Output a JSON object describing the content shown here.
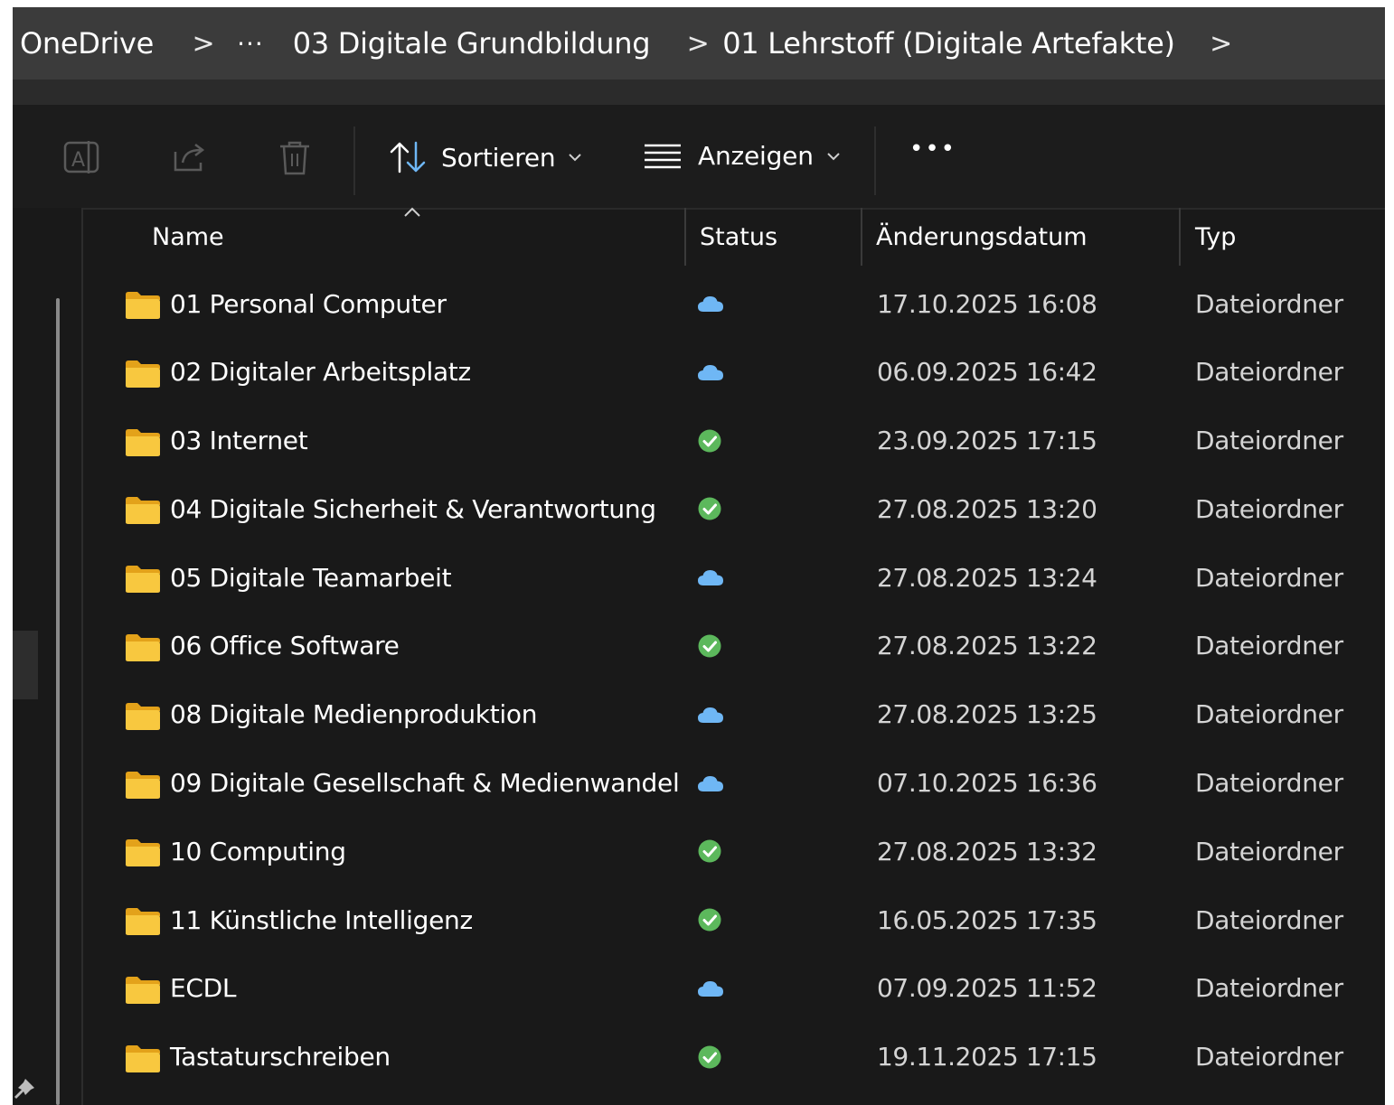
{
  "breadcrumb": {
    "items": [
      "OneDrive",
      "···",
      "03 Digitale Grundbildung",
      "01 Lehrstoff (Digitale Artefakte)"
    ],
    "separator": ">"
  },
  "toolbar": {
    "sort_label": "Sortieren",
    "view_label": "Anzeigen",
    "more_label": "•••"
  },
  "columns": {
    "name": "Name",
    "status": "Status",
    "modified": "Änderungsdatum",
    "type": "Typ"
  },
  "colors": {
    "background": "#191919",
    "address_bar": "#3b3b3b",
    "folder": "#f5c542",
    "cloud": "#6fb7f5",
    "synced": "#5cb85c"
  },
  "rows": [
    {
      "name": "01 Personal Computer",
      "status": "cloud",
      "modified": "17.10.2025 16:08",
      "type": "Dateiordner"
    },
    {
      "name": "02 Digitaler Arbeitsplatz",
      "status": "cloud",
      "modified": "06.09.2025 16:42",
      "type": "Dateiordner"
    },
    {
      "name": "03 Internet",
      "status": "synced",
      "modified": "23.09.2025 17:15",
      "type": "Dateiordner"
    },
    {
      "name": "04 Digitale Sicherheit & Verantwortung",
      "status": "synced",
      "modified": "27.08.2025 13:20",
      "type": "Dateiordner"
    },
    {
      "name": "05 Digitale Teamarbeit",
      "status": "cloud",
      "modified": "27.08.2025 13:24",
      "type": "Dateiordner"
    },
    {
      "name": "06 Office Software",
      "status": "synced",
      "modified": "27.08.2025 13:22",
      "type": "Dateiordner"
    },
    {
      "name": "08 Digitale Medienproduktion",
      "status": "cloud",
      "modified": "27.08.2025 13:25",
      "type": "Dateiordner"
    },
    {
      "name": "09 Digitale Gesellschaft & Medienwandel",
      "status": "cloud",
      "modified": "07.10.2025 16:36",
      "type": "Dateiordner"
    },
    {
      "name": "10 Computing",
      "status": "synced",
      "modified": "27.08.2025 13:32",
      "type": "Dateiordner"
    },
    {
      "name": "11 Künstliche Intelligenz",
      "status": "synced",
      "modified": "16.05.2025 17:35",
      "type": "Dateiordner"
    },
    {
      "name": "ECDL",
      "status": "cloud",
      "modified": "07.09.2025 11:52",
      "type": "Dateiordner"
    },
    {
      "name": "Tastaturschreiben",
      "status": "synced",
      "modified": "19.11.2025 17:15",
      "type": "Dateiordner"
    }
  ]
}
